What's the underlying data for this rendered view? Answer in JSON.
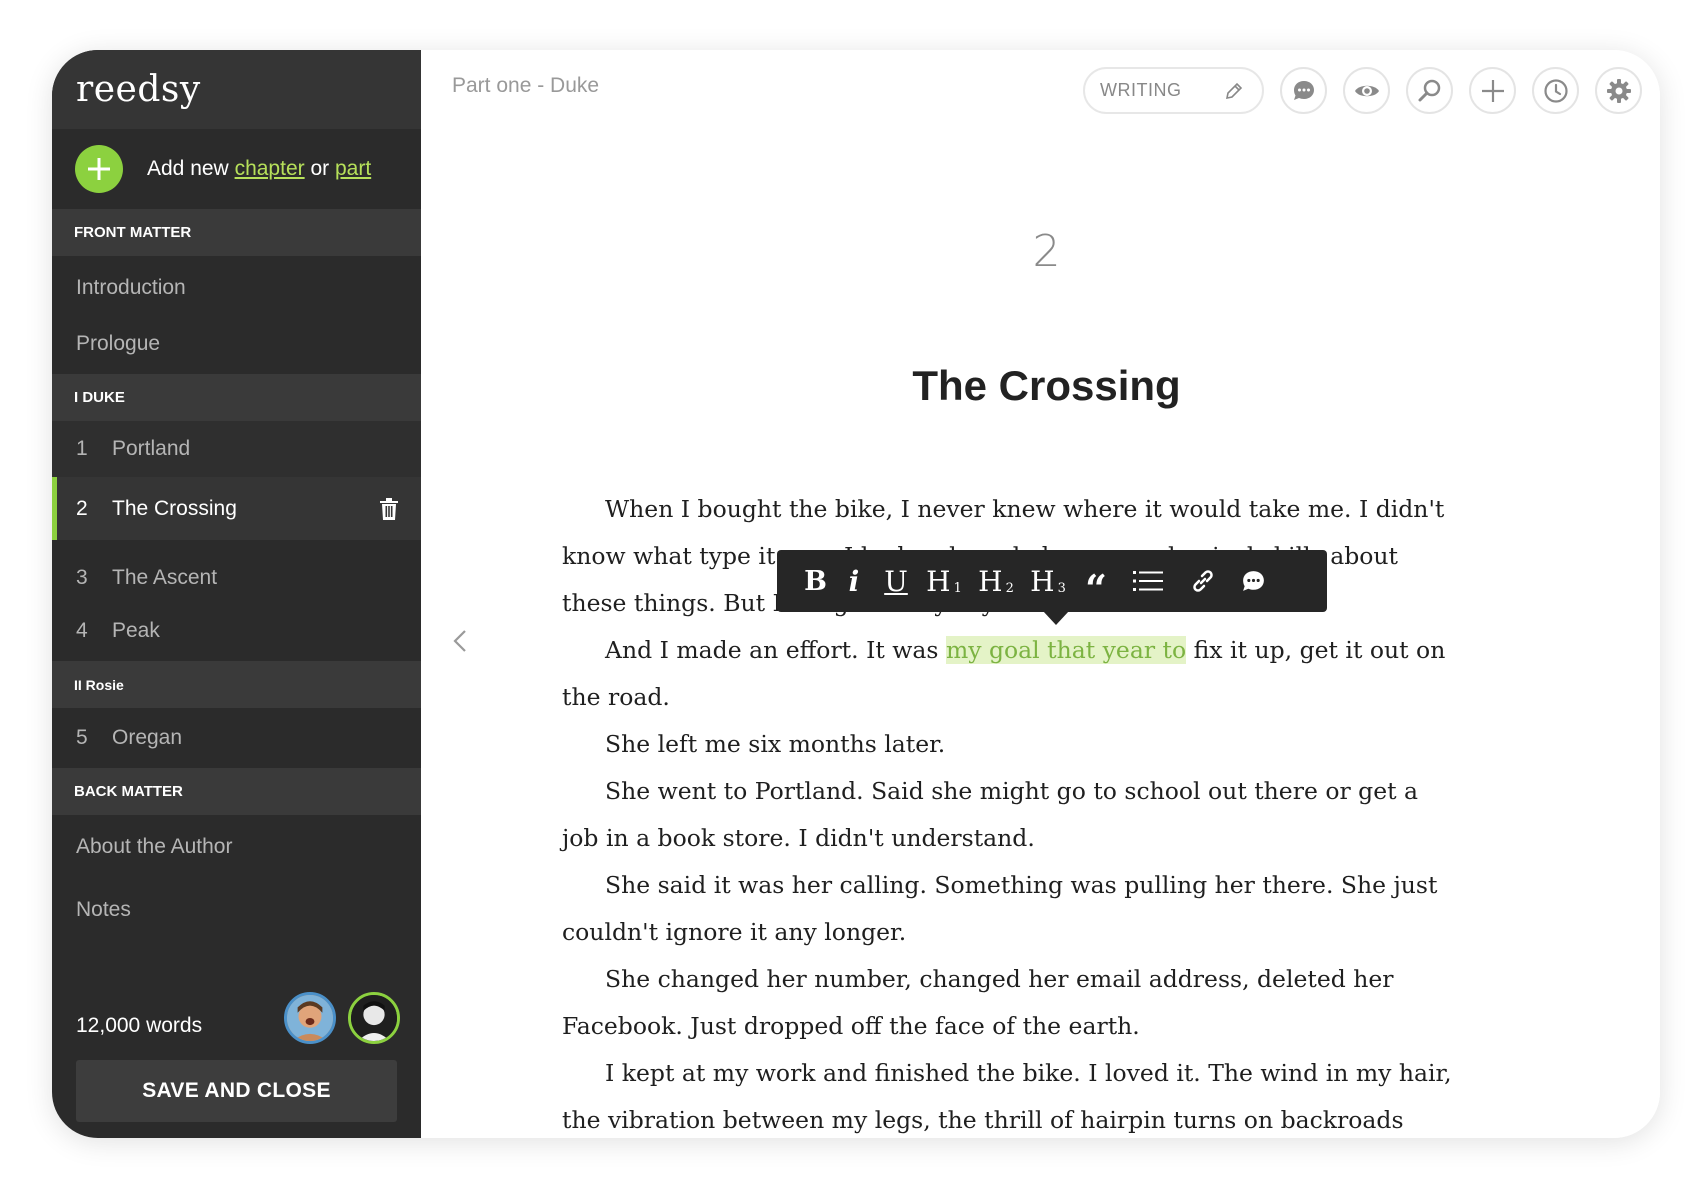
{
  "app": {
    "logo": "reedsy"
  },
  "sidebar": {
    "add": {
      "prefix": "Add new",
      "chapter": "chapter",
      "or": "or",
      "part": "part"
    },
    "sections": {
      "front": "FRONT MATTER",
      "part1": "I DUKE",
      "part2": "II Rosie",
      "back": "BACK MATTER"
    },
    "front_items": [
      "Introduction",
      "Prologue"
    ],
    "part1_items": [
      {
        "num": "1",
        "label": "Portland"
      },
      {
        "num": "2",
        "label": "The Crossing"
      },
      {
        "num": "3",
        "label": "The Ascent"
      },
      {
        "num": "4",
        "label": "Peak"
      }
    ],
    "part2_items": [
      {
        "num": "5",
        "label": "Oregan"
      }
    ],
    "back_items": [
      "About the Author",
      "Notes"
    ],
    "word_count": "12,000 words",
    "save_label": "SAVE AND CLOSE"
  },
  "header": {
    "breadcrumb": "Part one - Duke",
    "mode": "WRITING"
  },
  "chapter": {
    "number": "2",
    "title": "The Crossing"
  },
  "body": {
    "p1": "When I bought the bike, I never knew where it would take me. I didn't know what type it was. I had no knowledge or mechanical skills about these things. But I bought it anyway.",
    "p2_before": "And I made an effort. It was ",
    "p2_highlight": "my goal that year to",
    "p2_after": " fix it up, get it out on the road.",
    "p3": "She left me six months later.",
    "p4": "She went to Portland. Said she might go to school out there or get a job in a book store. I didn't understand.",
    "p5": "She said it was her calling. Something was pulling her there. She just couldn't ignore it any longer.",
    "p6": "She changed her number, changed her email address, deleted her Facebook. Just dropped off the face of the earth.",
    "p7": "I kept at my work and finished the bike. I loved it. The wind in my hair, the vibration between my legs, the thrill of hairpin turns on backroads and"
  },
  "format_bar": {
    "bold": "B",
    "italic": "i",
    "underline": "U",
    "h": "H",
    "h1": "1",
    "h2": "2",
    "h3": "3",
    "quote": "“"
  },
  "colors": {
    "accent": "#8cd13f",
    "sidebar": "#2b2b2b",
    "highlight": "#e4f3c7"
  }
}
